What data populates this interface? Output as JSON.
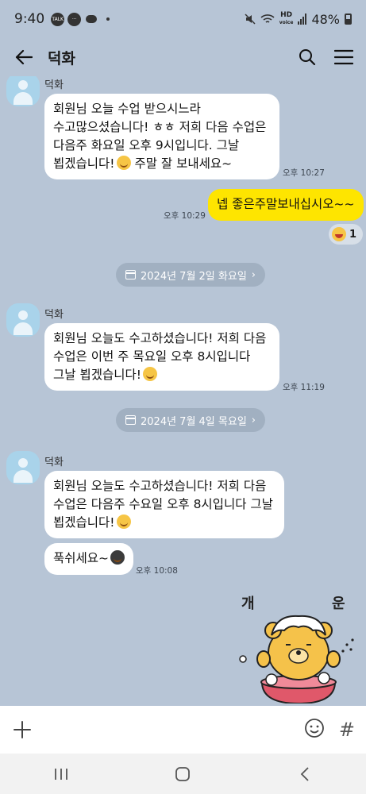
{
  "status_bar": {
    "time": "9:40",
    "talk_badge": "TALK",
    "battery": "48%",
    "hd": "HD",
    "voice": "voice"
  },
  "header": {
    "title": "덕화"
  },
  "messages": [
    {
      "sender": "덕화",
      "text": "회원님 오늘 수업 받으시느라\n수고많으셨습니다! ㅎㅎ 저희 다음 수업은\n다음주 화요일 오후 9시입니다. 그날\n뵙겠습니다!",
      "text_tail": " 주말 잘 보내세요~",
      "time": "오후 10:27"
    },
    {
      "text": "넵 좋은주말보내십시오~~",
      "time": "오후 10:29",
      "reaction_count": "1"
    }
  ],
  "date_1": "2024년 7월 2일 화요일",
  "message_3": {
    "sender": "덕화",
    "text": "회원님 오늘도 수고하셨습니다! 저희 다음\n수업은 이번 주 목요일 오후 8시입니다\n그날 뵙겠습니다!",
    "time": "오후 11:19"
  },
  "date_2": "2024년 7월 4일 목요일",
  "message_4": {
    "sender": "덕화",
    "text": "회원님 오늘도 수고하셨습니다! 저희 다음\n수업은 다음주 수요일 오후 8시입니다 그날\n뵙겠습니다!"
  },
  "message_5": {
    "text": "푹쉬세요~",
    "time": "오후 10:08"
  },
  "sticker": {
    "left_char": "개",
    "right_char": "운"
  },
  "input": {
    "hash": "#"
  }
}
